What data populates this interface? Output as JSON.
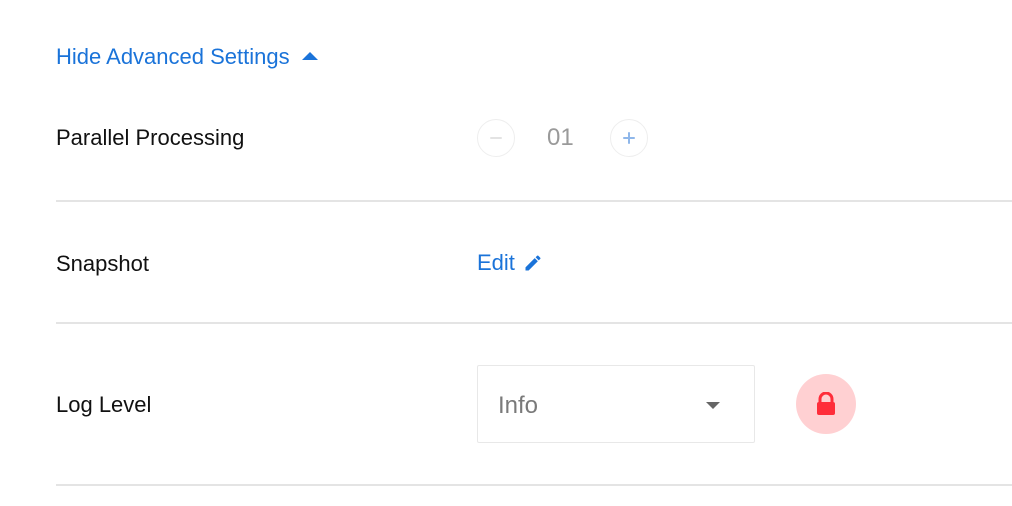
{
  "advanced_toggle": {
    "label": "Hide Advanced Settings",
    "icon": "caret-up-icon",
    "color": "#1a73d9"
  },
  "rows": {
    "parallel_processing": {
      "label": "Parallel Processing",
      "value": "01",
      "decrement_icon": "minus-icon",
      "increment_icon": "plus-icon"
    },
    "snapshot": {
      "label": "Snapshot",
      "action_label": "Edit",
      "action_icon": "pencil-icon"
    },
    "log_level": {
      "label": "Log Level",
      "selected": "Info",
      "dropdown_icon": "chevron-down-icon",
      "lock_icon": "lock-icon",
      "lock_color": "#ff2d3a",
      "lock_bg": "#ffd0d2"
    }
  }
}
